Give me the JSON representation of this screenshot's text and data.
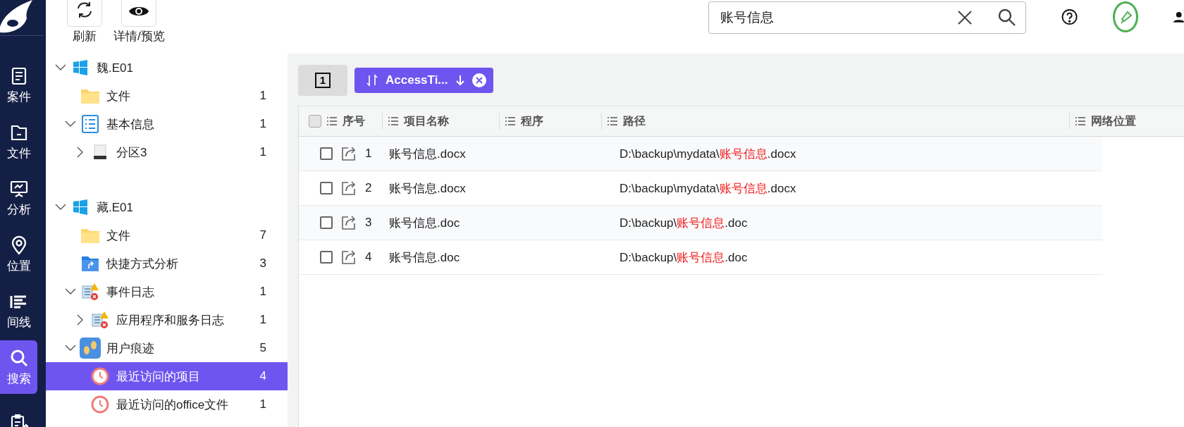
{
  "nav": {
    "items": [
      {
        "kind": "case",
        "label": "案件",
        "selected": false
      },
      {
        "kind": "file",
        "label": "文件",
        "selected": false
      },
      {
        "kind": "analysis",
        "label": "分析",
        "selected": false
      },
      {
        "kind": "location",
        "label": "位置",
        "selected": false
      },
      {
        "kind": "timeline",
        "label": "间线",
        "selected": false
      },
      {
        "kind": "search",
        "label": "搜索",
        "selected": true
      },
      {
        "kind": "clipboard",
        "selected": false
      }
    ]
  },
  "toolbar": {
    "buttons": [
      {
        "kind": "refresh",
        "label": "刷新"
      },
      {
        "kind": "eye",
        "label": "详情/预览"
      }
    ]
  },
  "tree": [
    {
      "label": "魏.E01",
      "kind": "windows",
      "expanded": true,
      "selected": false,
      "children": [
        {
          "label": "文件",
          "kind": "folder",
          "count": "1",
          "selected": false
        },
        {
          "label": "基本信息",
          "kind": "list",
          "count": "1",
          "expanded": true,
          "selected": false,
          "children": [
            {
              "label": "分区3",
              "kind": "drive",
              "count": "1",
              "expanded": false,
              "selected": false
            }
          ]
        }
      ]
    },
    {
      "label": "藏.E01",
      "kind": "windows",
      "expanded": true,
      "selected": false,
      "children": [
        {
          "label": "文件",
          "kind": "folder",
          "count": "7",
          "selected": false
        },
        {
          "label": "快捷方式分析",
          "kind": "shortcut",
          "count": "3",
          "selected": false
        },
        {
          "label": "事件日志",
          "kind": "eventlog",
          "count": "1",
          "expanded": true,
          "selected": false,
          "children": [
            {
              "label": "应用程序和服务日志",
              "kind": "eventlog",
              "count": "1",
              "expanded": false,
              "selected": false
            }
          ]
        },
        {
          "label": "用户痕迹",
          "kind": "footprints",
          "count": "5",
          "expanded": true,
          "selected": false,
          "children": [
            {
              "label": "最近访问的项目",
              "kind": "clock",
              "count": "4",
              "selected": true
            },
            {
              "label": "最近访问的office文件",
              "kind": "clock",
              "count": "1",
              "selected": false
            }
          ]
        }
      ]
    }
  ],
  "search": {
    "value": "账号信息"
  },
  "filter_bar": {
    "count_button": "1",
    "sort_chip": {
      "label": "AccessTi...",
      "descending": true
    }
  },
  "table": {
    "all_checked": false,
    "columns": [
      "序号",
      "项目名称",
      "程序",
      "路径",
      "网络位置"
    ],
    "rows": [
      {
        "checked": false,
        "number": "1",
        "name": "账号信息.docx",
        "path": [
          {
            "text": "D:\\backup\\mydata\\",
            "highlight": false
          },
          {
            "text": "账号信息",
            "highlight": true
          },
          {
            "text": ".docx",
            "highlight": false
          }
        ]
      },
      {
        "checked": false,
        "number": "2",
        "name": "账号信息.docx",
        "path": [
          {
            "text": "D:\\backup\\mydata\\",
            "highlight": false
          },
          {
            "text": "账号信息",
            "highlight": true
          },
          {
            "text": ".docx",
            "highlight": false
          }
        ]
      },
      {
        "checked": false,
        "number": "3",
        "name": "账号信息.doc",
        "path": [
          {
            "text": "D:\\backup\\",
            "highlight": false
          },
          {
            "text": "账号信息",
            "highlight": true
          },
          {
            "text": ".doc",
            "highlight": false
          }
        ]
      },
      {
        "checked": false,
        "number": "4",
        "name": "账号信息.doc",
        "path": [
          {
            "text": "D:\\backup\\",
            "highlight": false
          },
          {
            "text": "账号信息",
            "highlight": true
          },
          {
            "text": ".doc",
            "highlight": false
          }
        ]
      }
    ]
  }
}
